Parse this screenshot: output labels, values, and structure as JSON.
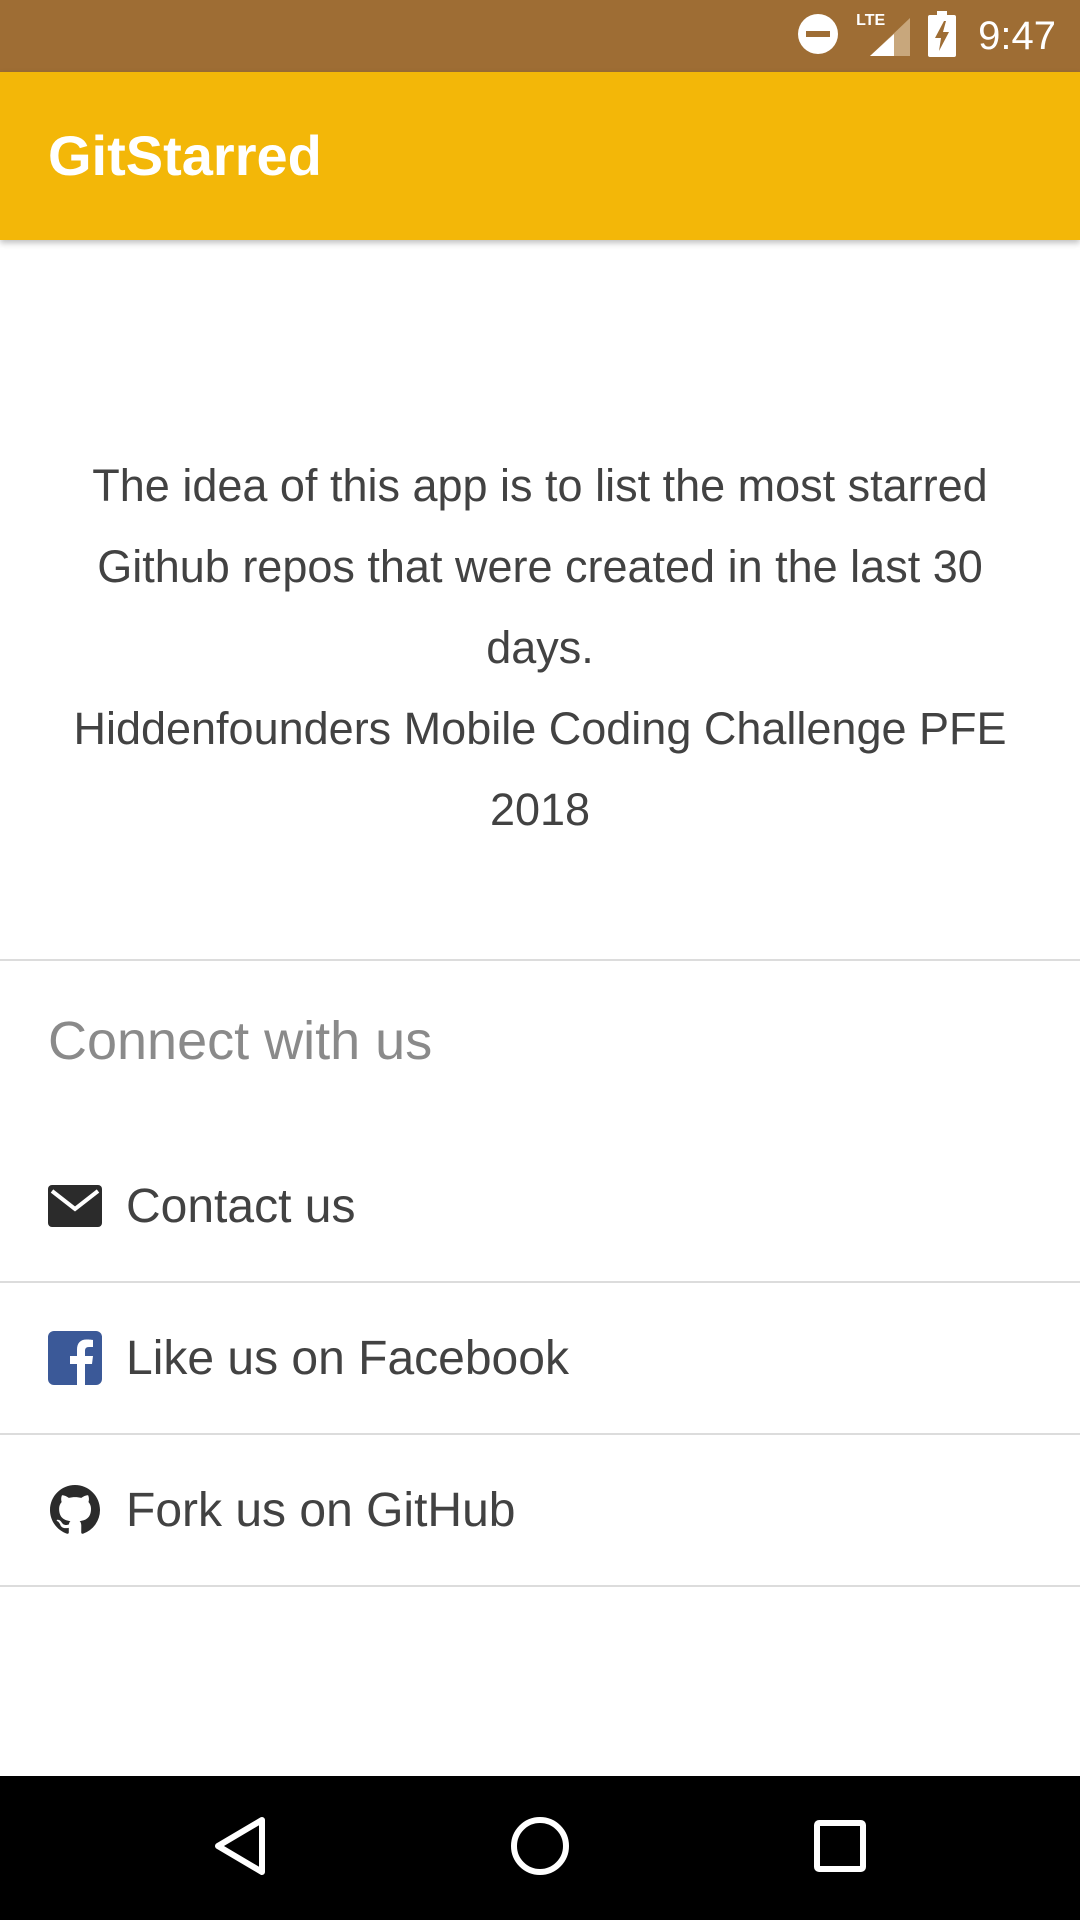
{
  "status_bar": {
    "time": "9:47",
    "network": "LTE",
    "icons": [
      "do-not-disturb-icon",
      "signal-icon",
      "battery-charging-icon"
    ]
  },
  "app_bar": {
    "title": "GitStarred",
    "color": "#f3b708"
  },
  "about": {
    "description": "The idea of this app is to list the most starred Github repos that were created in the last 30 days.",
    "challenge": "Hiddenfounders Mobile Coding Challenge PFE 2018"
  },
  "connect": {
    "title": "Connect with us",
    "items": [
      {
        "label": "Contact us",
        "icon": "envelope-icon"
      },
      {
        "label": "Like us on Facebook",
        "icon": "facebook-icon",
        "color": "#3b5998"
      },
      {
        "label": "Fork us on GitHub",
        "icon": "github-icon"
      }
    ]
  },
  "nav_bar": {
    "buttons": [
      "back-icon",
      "home-icon",
      "recents-icon"
    ]
  }
}
